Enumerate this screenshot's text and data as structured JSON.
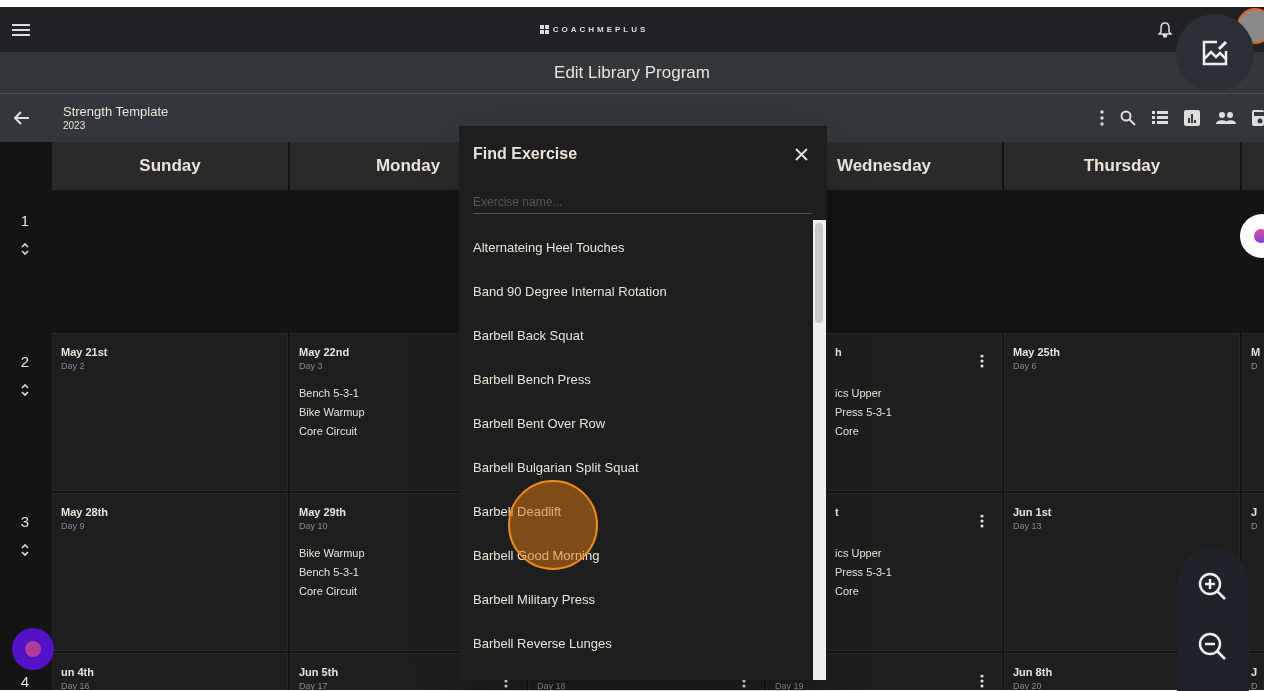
{
  "app_bar": {
    "logo": "COACHMEPLUS"
  },
  "title": "Edit Library Program",
  "program": {
    "name": "Strength Template",
    "year": "2023"
  },
  "day_headers": [
    "Sunday",
    "Monday",
    "Wednesday",
    "Thursday"
  ],
  "weeks": [
    {
      "number": "1",
      "reorder": true
    },
    {
      "number": "2",
      "reorder": true,
      "cells": [
        {
          "date": "May 21st",
          "day": "Day 2"
        },
        {
          "date": "May 22nd",
          "day": "Day 3",
          "workouts": [
            "Bench 5-3-1",
            "Bike Warmup",
            "Core Circuit"
          ]
        },
        {
          "kind": "hidden"
        },
        {
          "kind": "clipped",
          "date": "h",
          "workouts": [
            "ics Upper",
            "Press 5-3-1",
            "Core"
          ],
          "menu": true
        },
        {
          "date": "May 25th",
          "day": "Day 6"
        },
        {
          "date": "M",
          "day": "D"
        }
      ]
    },
    {
      "number": "3",
      "reorder": true,
      "cells": [
        {
          "date": "May 28th",
          "day": "Day 9"
        },
        {
          "date": "May 29th",
          "day": "Day 10",
          "workouts": [
            "Bike Warmup",
            "Bench 5-3-1",
            "Core Circuit"
          ]
        },
        {
          "kind": "hidden"
        },
        {
          "kind": "clipped",
          "date": "t",
          "workouts": [
            "ics Upper",
            "Press 5-3-1",
            "Core"
          ],
          "menu": true
        },
        {
          "date": "Jun 1st",
          "day": "Day 13"
        },
        {
          "date": "J",
          "day": "D"
        }
      ]
    },
    {
      "number": "4",
      "cells": [
        {
          "date": "un 4th",
          "day": "Day 16"
        },
        {
          "date": "Jun 5th",
          "day": "Day 17",
          "menu": true
        },
        {
          "day": "Day 18",
          "menu": true
        },
        {
          "day": "Day 19",
          "menu": true
        },
        {
          "date": "Jun 8th",
          "day": "Day 20"
        },
        {
          "date": "J",
          "day": "D"
        }
      ]
    }
  ],
  "dialog": {
    "title": "Find Exercise",
    "placeholder": "Exercise name...",
    "items": [
      "Alternateing Heel Touches",
      "Band 90 Degree Internal Rotation",
      "Barbell Back Squat",
      "Barbell Bench Press",
      "Barbell Bent Over Row",
      "Barbell Bulgarian Split Squat",
      "Barbell Deadlift",
      "Barbell Good Morning",
      "Barbell Military Press",
      "Barbell Reverse Lunges"
    ]
  }
}
